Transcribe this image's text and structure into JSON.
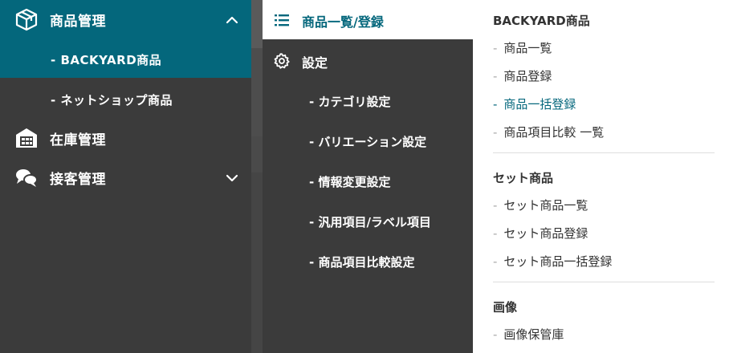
{
  "main_nav": {
    "products": {
      "label": "商品管理",
      "icon": "box-icon"
    },
    "sub_items": [
      {
        "label": "- BACKYARD商品"
      },
      {
        "label": "- ネットショップ商品"
      }
    ],
    "inventory": {
      "label": "在庫管理",
      "icon": "warehouse-icon"
    },
    "customer": {
      "label": "接客管理",
      "icon": "chat-bubbles-icon"
    }
  },
  "sub_nav": {
    "list_register": {
      "label": "商品一覧/登録",
      "icon": "list-icon"
    },
    "settings": {
      "label": "設定",
      "icon": "gear-icon"
    },
    "settings_items": [
      {
        "label": "- カテゴリ設定"
      },
      {
        "label": "- バリエーション設定"
      },
      {
        "label": "- 情報変更設定"
      },
      {
        "label": "- 汎用項目/ラベル項目"
      },
      {
        "label": "- 商品項目比較設定"
      }
    ]
  },
  "detail": {
    "sections": [
      {
        "title": "BACKYARD商品",
        "links": [
          {
            "label": "商品一覧"
          },
          {
            "label": "商品登録"
          },
          {
            "label": "商品一括登録"
          },
          {
            "label": "商品項目比較 一覧"
          }
        ]
      },
      {
        "title": "セット商品",
        "links": [
          {
            "label": "セット商品一覧"
          },
          {
            "label": "セット商品登録"
          },
          {
            "label": "セット商品一括登録"
          }
        ]
      },
      {
        "title": "画像",
        "links": [
          {
            "label": "画像保管庫"
          }
        ]
      }
    ],
    "dash": "-"
  },
  "colors": {
    "accent": "#04677c",
    "nav_bg": "#3b3b3b",
    "panel_bg": "#ffffff"
  }
}
